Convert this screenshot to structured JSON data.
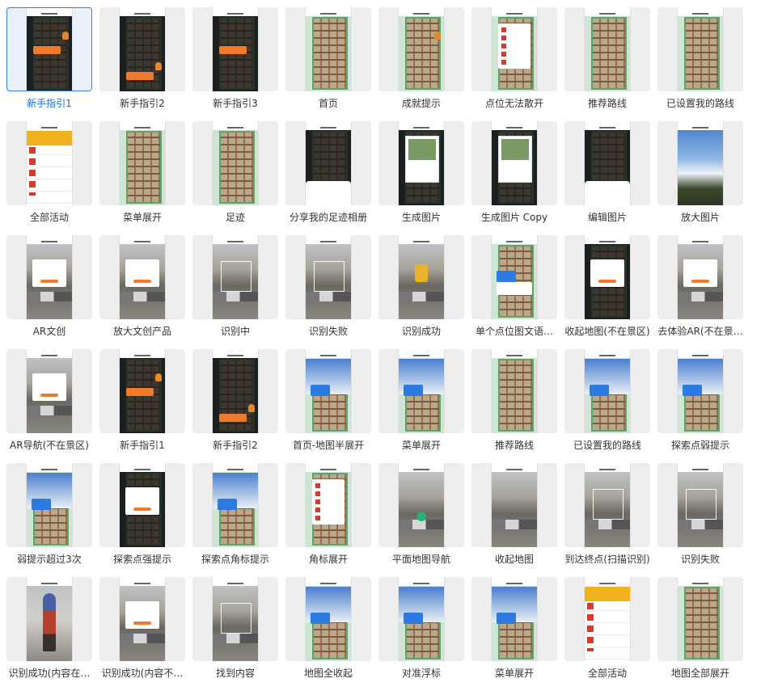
{
  "selected_index": 0,
  "items": [
    {
      "label": "新手指引1",
      "theme": "mapdark",
      "overlay": "tip-fox"
    },
    {
      "label": "新手指引2",
      "theme": "mapdark",
      "overlay": "tip-low"
    },
    {
      "label": "新手指引3",
      "theme": "mapdark",
      "overlay": "tip"
    },
    {
      "label": "首页",
      "theme": "map",
      "overlay": "none"
    },
    {
      "label": "成就提示",
      "theme": "map",
      "overlay": "badge"
    },
    {
      "label": "点位无法散开",
      "theme": "map",
      "overlay": "menu"
    },
    {
      "label": "推荐路线",
      "theme": "map",
      "overlay": "none"
    },
    {
      "label": "已设置我的路线",
      "theme": "map",
      "overlay": "none"
    },
    {
      "label": "全部活动",
      "theme": "white",
      "overlay": "list"
    },
    {
      "label": "菜单展开",
      "theme": "map",
      "overlay": "none"
    },
    {
      "label": "足迹",
      "theme": "map",
      "overlay": "none"
    },
    {
      "label": "分享我的足迹相册",
      "theme": "mapdark",
      "overlay": "sheet"
    },
    {
      "label": "生成图片",
      "theme": "mapdark",
      "overlay": "photo"
    },
    {
      "label": "生成图片 Copy",
      "theme": "mapdark",
      "overlay": "photo"
    },
    {
      "label": "编辑图片",
      "theme": "mapdark",
      "overlay": "sheet"
    },
    {
      "label": "放大图片",
      "theme": "sky",
      "overlay": "none"
    },
    {
      "label": "AR文创",
      "theme": "street",
      "overlay": "dialog"
    },
    {
      "label": "放大文创产品",
      "theme": "street",
      "overlay": "dialog"
    },
    {
      "label": "识别中",
      "theme": "street",
      "overlay": "scan"
    },
    {
      "label": "识别失败",
      "theme": "street",
      "overlay": "scan"
    },
    {
      "label": "识别成功",
      "theme": "street",
      "overlay": "ar"
    },
    {
      "label": "单个点位图文语…",
      "theme": "map",
      "overlay": "card"
    },
    {
      "label": "收起地图(不在景区)",
      "theme": "mapdark",
      "overlay": "dialog"
    },
    {
      "label": "去体验AR(不在景…",
      "theme": "street",
      "overlay": "dialog"
    },
    {
      "label": "AR导航(不在景区)",
      "theme": "street",
      "overlay": "dialog"
    },
    {
      "label": "新手指引1",
      "theme": "mapdark",
      "overlay": "tip-fox"
    },
    {
      "label": "新手指引2",
      "theme": "mapdark",
      "overlay": "tip-low"
    },
    {
      "label": "首页-地图半展开",
      "theme": "map",
      "overlay": "half"
    },
    {
      "label": "菜单展开",
      "theme": "map",
      "overlay": "half"
    },
    {
      "label": "推荐路线",
      "theme": "map",
      "overlay": "none"
    },
    {
      "label": "已设置我的路线",
      "theme": "map",
      "overlay": "half"
    },
    {
      "label": "探索点弱提示",
      "theme": "map",
      "overlay": "half"
    },
    {
      "label": "弱提示超过3次",
      "theme": "map",
      "overlay": "half"
    },
    {
      "label": "探索点强提示",
      "theme": "mapdark",
      "overlay": "dialog"
    },
    {
      "label": "探索点角标提示",
      "theme": "map",
      "overlay": "half"
    },
    {
      "label": "角标展开",
      "theme": "map",
      "overlay": "menu"
    },
    {
      "label": "平面地图导航",
      "theme": "street",
      "overlay": "pin"
    },
    {
      "label": "收起地图",
      "theme": "street",
      "overlay": "none"
    },
    {
      "label": "到达终点(扫描识别)",
      "theme": "street",
      "overlay": "scan"
    },
    {
      "label": "识别失败",
      "theme": "street",
      "overlay": "scan"
    },
    {
      "label": "识别成功(内容在…",
      "theme": "person",
      "overlay": "person"
    },
    {
      "label": "识别成功(内容不…",
      "theme": "street",
      "overlay": "dialog"
    },
    {
      "label": "找到内容",
      "theme": "street",
      "overlay": "scan"
    },
    {
      "label": "地图全收起",
      "theme": "map",
      "overlay": "half"
    },
    {
      "label": "对准浮标",
      "theme": "map",
      "overlay": "half"
    },
    {
      "label": "菜单展开",
      "theme": "map",
      "overlay": "half"
    },
    {
      "label": "全部活动",
      "theme": "white",
      "overlay": "list"
    },
    {
      "label": "地图全部展开",
      "theme": "map",
      "overlay": "none"
    }
  ]
}
